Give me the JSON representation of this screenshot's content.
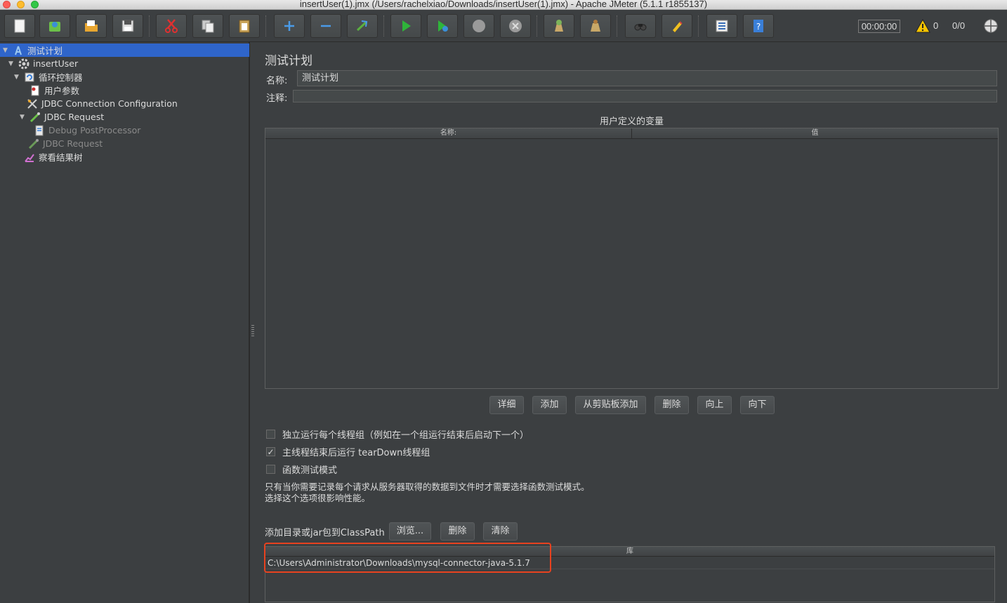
{
  "window": {
    "title": "insertUser(1).jmx (/Users/rachelxiao/Downloads/insertUser(1).jmx) - Apache JMeter (5.1.1 r1855137)"
  },
  "toolbar": {
    "timer": "00:00:00",
    "warning_count": "0",
    "thread_count": "0/0",
    "buttons": [
      "new-icon",
      "templates-icon",
      "open-icon",
      "save-icon",
      "cut-icon",
      "copy-icon",
      "paste-icon",
      "expand-icon",
      "collapse-icon",
      "toggle-icon",
      "start-icon",
      "start-no-pause-icon",
      "stop-icon",
      "shutdown-icon",
      "clear-icon",
      "clear-all-icon",
      "search-icon",
      "reset-search-icon",
      "function-helper-icon",
      "help-icon"
    ]
  },
  "tree": [
    {
      "label": "测试计划",
      "icon": "test-plan-icon",
      "selected": true,
      "expanded": true
    },
    {
      "label": "insertUser",
      "icon": "thread-group-icon",
      "expanded": true
    },
    {
      "label": "循环控制器",
      "icon": "loop-controller-icon",
      "expanded": true
    },
    {
      "label": "用户参数",
      "icon": "user-params-icon"
    },
    {
      "label": "JDBC Connection Configuration",
      "icon": "config-icon"
    },
    {
      "label": "JDBC Request",
      "icon": "sampler-icon",
      "expanded": true
    },
    {
      "label": "Debug PostProcessor",
      "icon": "postprocessor-icon",
      "disabled": true
    },
    {
      "label": "JDBC Request",
      "icon": "sampler-icon",
      "disabled": true
    },
    {
      "label": "察看结果树",
      "icon": "listener-icon"
    }
  ],
  "main": {
    "panel_title": "测试计划",
    "name_label": "名称:",
    "name_value": "测试计划",
    "comment_label": "注释:",
    "comment_value": "",
    "vars_title": "用户定义的变量",
    "vars_col_name": "名称:",
    "vars_col_value": "值",
    "buttons": {
      "detail": "详细",
      "add": "添加",
      "add_clipboard": "从剪贴板添加",
      "delete": "删除",
      "up": "向上",
      "down": "向下"
    },
    "options": [
      {
        "label": "独立运行每个线程组（例如在一个组运行结束后启动下一个）",
        "checked": false
      },
      {
        "label": "主线程结束后运行 tearDown线程组",
        "checked": true
      },
      {
        "label": "函数测试模式",
        "checked": false
      }
    ],
    "note_line1": "只有当你需要记录每个请求从服务器取得的数据到文件时才需要选择函数测试模式。",
    "note_line2": "选择这个选项很影响性能。",
    "classpath_label": "添加目录或jar包到ClassPath",
    "classpath_buttons": {
      "browse": "浏览...",
      "delete": "删除",
      "clear": "清除"
    },
    "lib_header": "库",
    "lib_rows": [
      "C:\\Users\\Administrator\\Downloads\\mysql-connector-java-5.1.7"
    ]
  }
}
